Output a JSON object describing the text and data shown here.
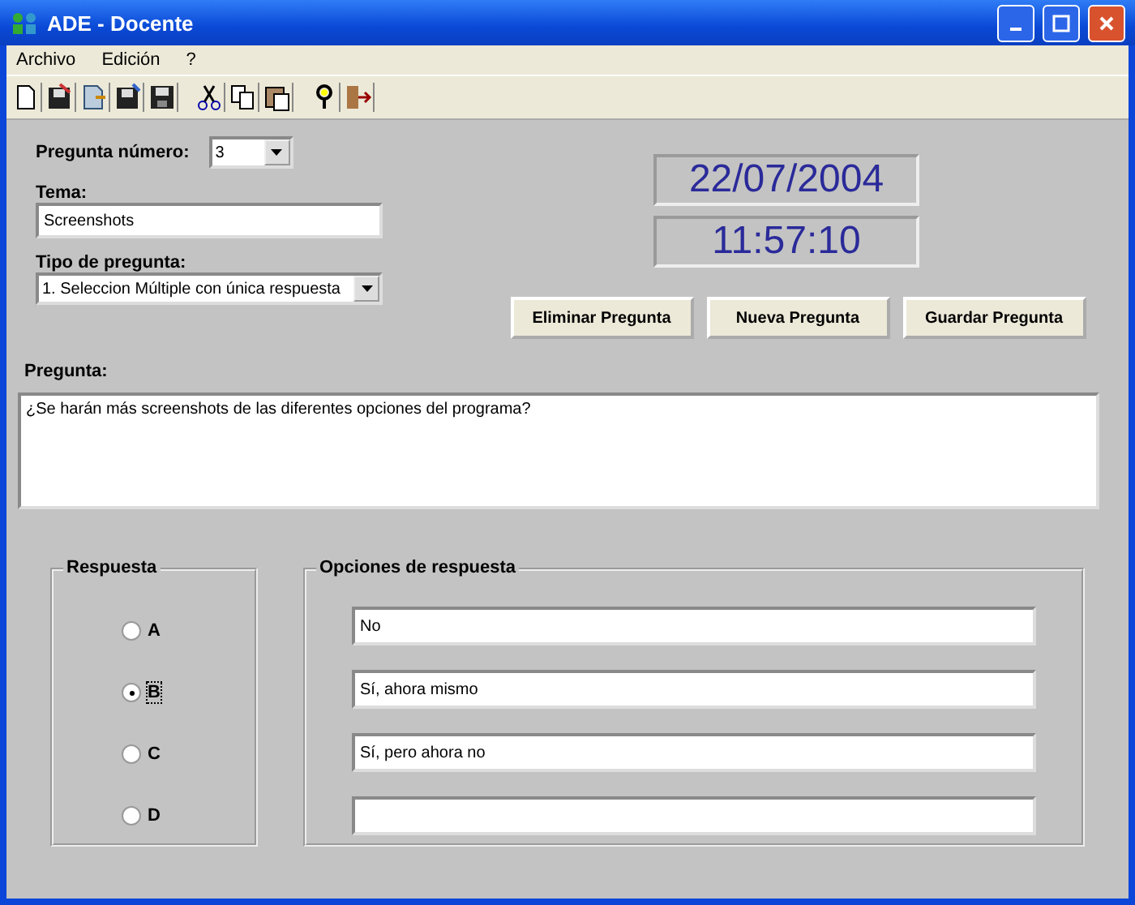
{
  "window": {
    "title": "ADE - Docente"
  },
  "menu": [
    "Archivo",
    "Edición",
    "?"
  ],
  "question_number": {
    "label": "Pregunta número:",
    "value": "3"
  },
  "topic": {
    "label": "Tema:",
    "value": "Screenshots"
  },
  "question_type": {
    "label": "Tipo de pregunta:",
    "value": "1. Seleccion Múltiple con única respuesta"
  },
  "date": "22/07/2004",
  "time": "11:57:10",
  "buttons": [
    "Eliminar Pregunta",
    "Nueva Pregunta",
    "Guardar Pregunta"
  ],
  "question": {
    "label": "Pregunta:",
    "value": "¿Se harán más screenshots de las diferentes opciones del programa?"
  },
  "answer": {
    "title": "Respuesta",
    "options": [
      {
        "label": "A",
        "selected": false
      },
      {
        "label": "B",
        "selected": true
      },
      {
        "label": "C",
        "selected": false
      },
      {
        "label": "D",
        "selected": false
      }
    ]
  },
  "answer_options": {
    "title": "Opciones de respuesta",
    "fields": [
      {
        "kind": "text",
        "value": "No"
      },
      {
        "kind": "text",
        "value": "Sí, ahora mismo"
      },
      {
        "kind": "text",
        "value": "Sí, pero ahora no"
      },
      {
        "kind": "blank"
      }
    ]
  }
}
